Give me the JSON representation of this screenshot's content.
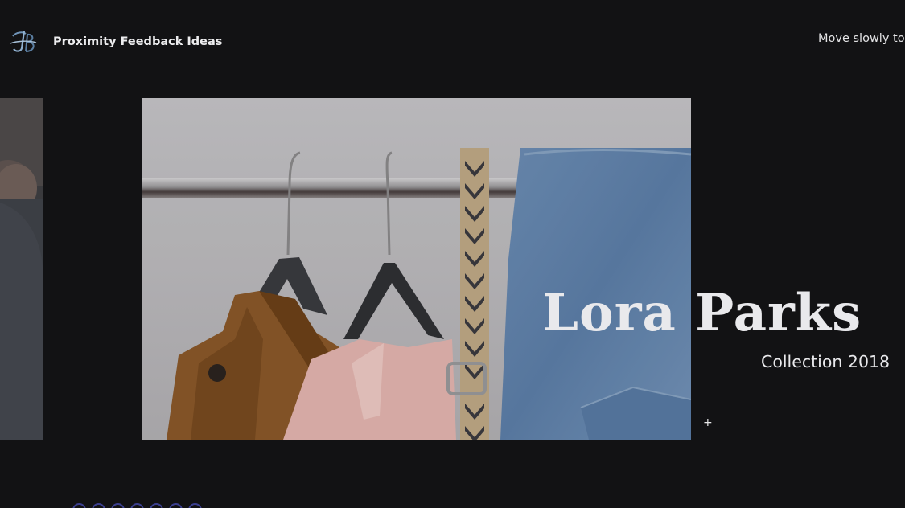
{
  "header": {
    "logo_icon": "monogram-logo-icon",
    "site_title": "Proximity Feedback Ideas",
    "hint_text": "Move slowly to"
  },
  "slider": {
    "current": {
      "title": "Lora Parks",
      "subtitle": "Collection 2018",
      "image_icon": "clothing-rack-photo"
    },
    "cursor_glyph": "+",
    "dots_count": 7
  },
  "colors": {
    "background": "#121214",
    "text": "#e9e9ec",
    "dot_border": "#3b3f8f"
  }
}
